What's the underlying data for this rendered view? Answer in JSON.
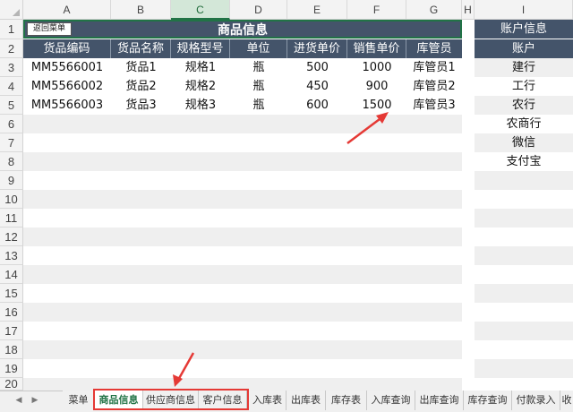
{
  "columns": [
    "A",
    "B",
    "C",
    "D",
    "E",
    "F",
    "G",
    "H",
    "I"
  ],
  "rows": [
    "1",
    "2",
    "3",
    "4",
    "5",
    "6",
    "7",
    "8",
    "9",
    "10",
    "11",
    "12",
    "13",
    "14",
    "15",
    "16",
    "17",
    "18",
    "19",
    "20"
  ],
  "back_button": "返回菜单",
  "main_title": "商品信息",
  "headers": [
    "货品编码",
    "货品名称",
    "规格型号",
    "单位",
    "进货单价",
    "销售单价",
    "库管员"
  ],
  "products": [
    [
      "MM5566001",
      "货品1",
      "规格1",
      "瓶",
      "500",
      "1000",
      "库管员1"
    ],
    [
      "MM5566002",
      "货品2",
      "规格2",
      "瓶",
      "450",
      "900",
      "库管员2"
    ],
    [
      "MM5566003",
      "货品3",
      "规格3",
      "瓶",
      "600",
      "1500",
      "库管员3"
    ]
  ],
  "accounts": {
    "title": "账户信息",
    "header": "账户",
    "items": [
      "建行",
      "工行",
      "农行",
      "农商行",
      "微信",
      "支付宝"
    ]
  },
  "sheet_tabs": [
    "菜单",
    "商品信息",
    "供应商信息",
    "客户信息",
    "入库表",
    "出库表",
    "库存表",
    "入库查询",
    "出库查询",
    "库存查询",
    "付款录入",
    "收"
  ],
  "active_tab": "商品信息",
  "nav_icons": [
    "scroll-left-icon",
    "scroll-right-icon"
  ]
}
